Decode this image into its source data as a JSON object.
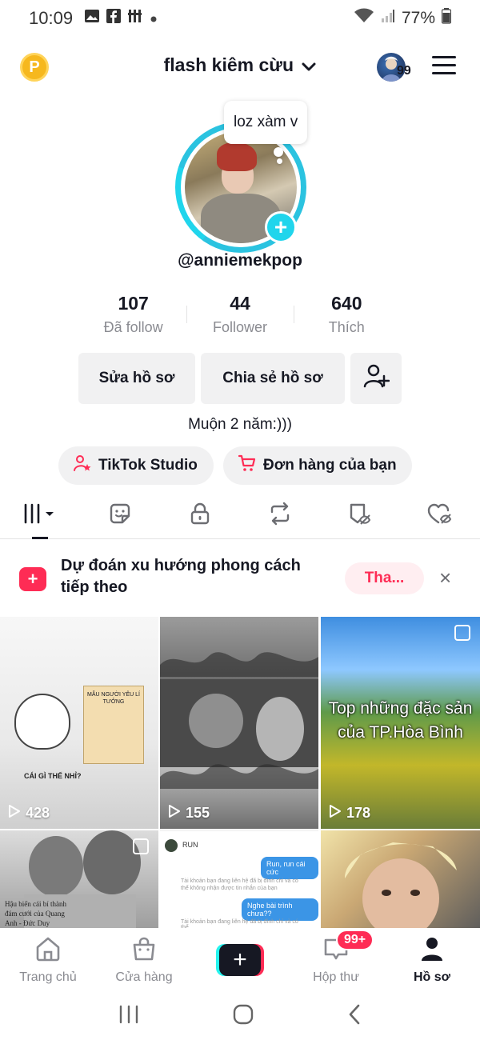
{
  "status_bar": {
    "time": "10:09",
    "battery": "77%"
  },
  "header": {
    "coin_label": "P",
    "account_name": "flash kiêm cừu",
    "avatar_badge": "99"
  },
  "profile": {
    "note_bubble": "loz xàm v",
    "handle": "@anniemekpop",
    "stats": [
      {
        "value": "107",
        "label": "Đã follow"
      },
      {
        "value": "44",
        "label": "Follower"
      },
      {
        "value": "640",
        "label": "Thích"
      }
    ],
    "edit_label": "Sửa hồ sơ",
    "share_label": "Chia sẻ hồ sơ",
    "bio": "Muộn 2 năm:)))",
    "studio_label": "TikTok Studio",
    "orders_label": "Đơn hàng của bạn"
  },
  "tabs": [
    "videos",
    "reposts-sticker",
    "private",
    "reposts",
    "favorites",
    "liked"
  ],
  "trend_banner": {
    "text": "Dự đoán xu hướng phong cách tiếp theo",
    "button_label": "Tha...",
    "close_label": "×"
  },
  "videos": [
    {
      "views": "428",
      "caption": "CÁI GÌ THẾ NHỈ?",
      "card_text": "MẪU NGƯỜI YÊU LÍ TƯỞNG"
    },
    {
      "views": "155"
    },
    {
      "views": "178",
      "caption": "Top những đặc sản của TP.Hòa Bình"
    },
    {
      "caption": "Hậu biến cái bí thành đám cưới của Quang Anh - Đức Duy"
    },
    {
      "chat_name": "RUN",
      "bubble1": "Run, run cái cức",
      "bubble2": "Nghe bài trình chưa??",
      "grey1": "Tài khoản bạn đang liên hệ đã bị đình chỉ và có thể không nhận được tin nhắn của bạn",
      "grey2": "Tài khoản bạn đang liên hệ đã bị đình chỉ và có thể"
    },
    {}
  ],
  "bottom_nav": {
    "home": "Trang chủ",
    "shop": "Cửa hàng",
    "create": "+",
    "inbox": "Hộp thư",
    "inbox_badge": "99+",
    "profile": "Hồ sơ"
  },
  "colors": {
    "accent": "#fe2c55",
    "cyan": "#20d5ec",
    "text": "#161823",
    "muted": "#8a8b91"
  }
}
